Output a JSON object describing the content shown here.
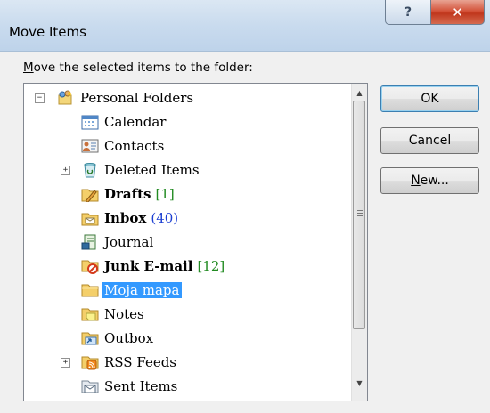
{
  "window": {
    "title": "Move Items",
    "help_glyph": "?",
    "close_glyph": "✕"
  },
  "dialog": {
    "prompt_first_letter": "M",
    "prompt_rest": "ove the selected items to the folder:"
  },
  "tree": {
    "root": {
      "label": "Personal Folders",
      "expander": "−",
      "icon": "personal-folders-icon"
    },
    "items": [
      {
        "label": "Calendar",
        "icon": "calendar-icon"
      },
      {
        "label": "Contacts",
        "icon": "contacts-icon"
      },
      {
        "label": "Deleted Items",
        "icon": "deleted-items-icon",
        "expander": "+"
      },
      {
        "label": "Drafts",
        "count": "[1]",
        "icon": "drafts-icon",
        "bold": true
      },
      {
        "label": "Inbox",
        "count": "(40)",
        "icon": "inbox-icon",
        "bold": true
      },
      {
        "label": "Journal",
        "icon": "journal-icon"
      },
      {
        "label": "Junk E-mail",
        "count": "[12]",
        "icon": "junk-email-icon",
        "bold": true
      },
      {
        "label": "Moja mapa",
        "icon": "folder-icon",
        "selected": true
      },
      {
        "label": "Notes",
        "icon": "notes-icon"
      },
      {
        "label": "Outbox",
        "icon": "outbox-icon"
      },
      {
        "label": "RSS Feeds",
        "icon": "rss-feeds-icon",
        "expander": "+"
      },
      {
        "label": "Sent Items",
        "icon": "sent-items-icon"
      }
    ]
  },
  "buttons": {
    "ok": "OK",
    "cancel": "Cancel",
    "new_first": "N",
    "new_rest": "ew..."
  },
  "colors": {
    "selection": "#3399ff",
    "count_blue": "#1c3fd2",
    "count_green": "#228b22"
  }
}
